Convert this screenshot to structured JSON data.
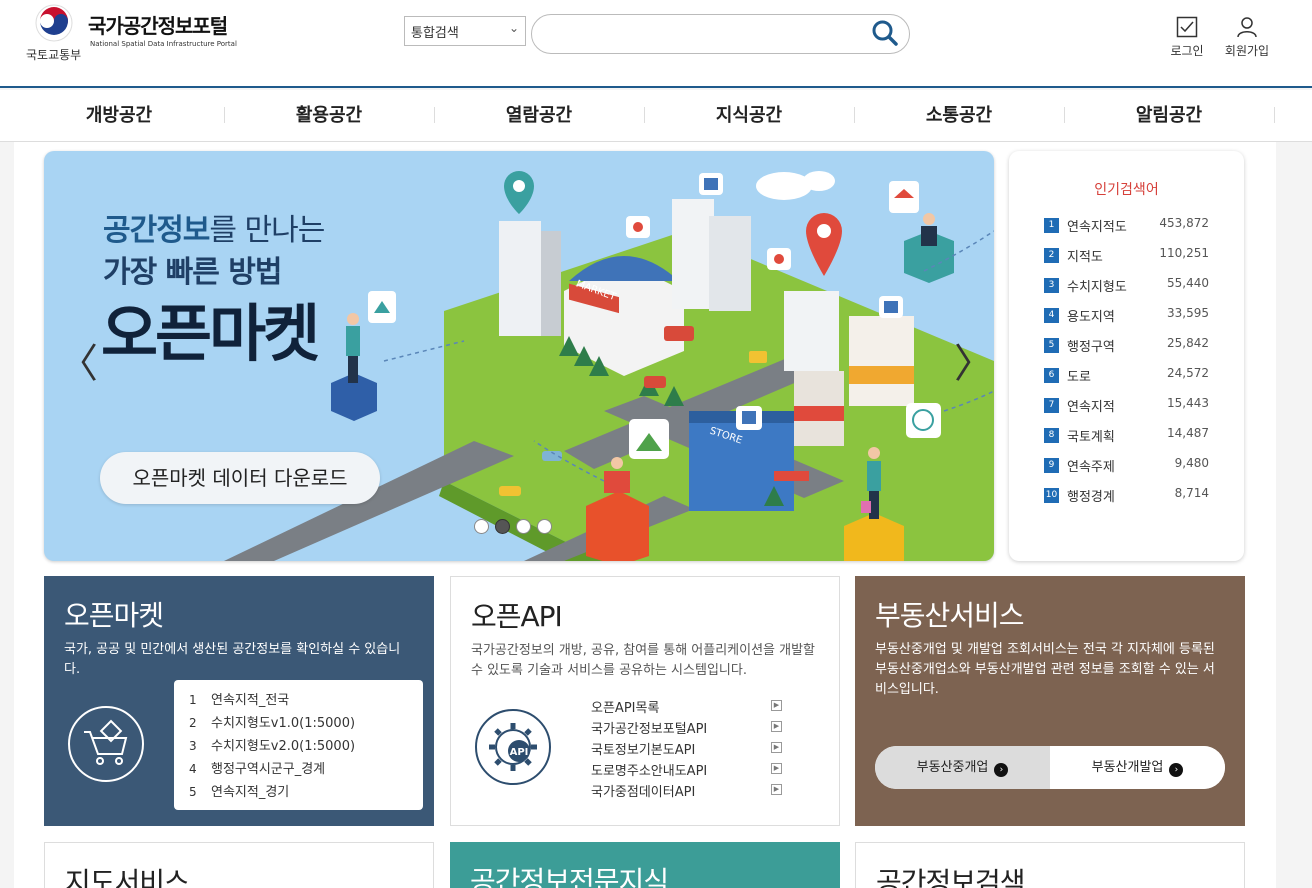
{
  "header": {
    "ministry": "국토교통부",
    "title": "국가공간정보포털",
    "subtitle": "National Spatial Data Infrastructure Portal",
    "search_select": "통합검색",
    "search_placeholder": "",
    "login_label": "로그인",
    "signup_label": "회원가입"
  },
  "nav": {
    "items": [
      "개방공간",
      "활용공간",
      "열람공간",
      "지식공간",
      "소통공간",
      "알림공간"
    ]
  },
  "banner": {
    "line1_bold": "공간정보",
    "line1_rest": "를 만나는",
    "line2": "가장 빠른 방법",
    "line3": "오픈마켓",
    "button_label": "오픈마켓 데이터 다운로드",
    "prev": "〈",
    "next": "〉",
    "sign_market": "MARKET",
    "sign_store": "STORE",
    "active_slide": 2,
    "slide_count": 4
  },
  "popular": {
    "title": "인기검색어",
    "items": [
      {
        "rank": "1",
        "term": "연속지적도",
        "count": "453,872"
      },
      {
        "rank": "2",
        "term": "지적도",
        "count": "110,251"
      },
      {
        "rank": "3",
        "term": "수치지형도",
        "count": "55,440"
      },
      {
        "rank": "4",
        "term": "용도지역",
        "count": "33,595"
      },
      {
        "rank": "5",
        "term": "행정구역",
        "count": "25,842"
      },
      {
        "rank": "6",
        "term": "도로",
        "count": "24,572"
      },
      {
        "rank": "7",
        "term": "연속지적",
        "count": "15,443"
      },
      {
        "rank": "8",
        "term": "국토계획",
        "count": "14,487"
      },
      {
        "rank": "9",
        "term": "연속주제",
        "count": "9,480"
      },
      {
        "rank": "10",
        "term": "행정경계",
        "count": "8,714"
      }
    ]
  },
  "cards": {
    "market": {
      "title": "오픈마켓",
      "desc": "국가, 공공 및 민간에서 생산된 공간정보를 확인하실 수 있습니다.",
      "items": [
        {
          "no": "1",
          "label": "연속지적_전국"
        },
        {
          "no": "2",
          "label": "수치지형도v1.0(1:5000)"
        },
        {
          "no": "3",
          "label": "수치지형도v2.0(1:5000)"
        },
        {
          "no": "4",
          "label": "행정구역시군구_경계"
        },
        {
          "no": "5",
          "label": "연속지적_경기"
        }
      ]
    },
    "api": {
      "title": "오픈API",
      "desc": "국가공간정보의 개방, 공유, 참여를 통해 어플리케이션을 개발할 수 있도록 기술과 서비스를 공유하는 시스템입니다.",
      "icon_label": "API",
      "items": [
        "오픈API목록",
        "국가공간정보포털API",
        "국토정보기본도API",
        "도로명주소안내도API",
        "국가중점데이터API"
      ]
    },
    "realestate": {
      "title": "부동산서비스",
      "desc": "부동산중개업 및 개발업 조회서비스는 전국 각 지자체에 등록된 부동산중개업소와 부동산개발업 관련 정보를 조회할 수 있는 서비스입니다.",
      "btn1": "부동산중개업",
      "btn2": "부동산개발업",
      "go": "›"
    },
    "map": {
      "title": "지도서비스"
    },
    "expert": {
      "title": "공간정보전문지식"
    },
    "search": {
      "title": "공간정보검색"
    }
  },
  "colors": {
    "brand_blue": "#1f5a8c",
    "market_card": "#3b5876",
    "realestate_card": "#7d6351",
    "expert_card": "#3c9d97",
    "rank_badge": "#1f6cb5",
    "popular_title": "#d6403a"
  }
}
